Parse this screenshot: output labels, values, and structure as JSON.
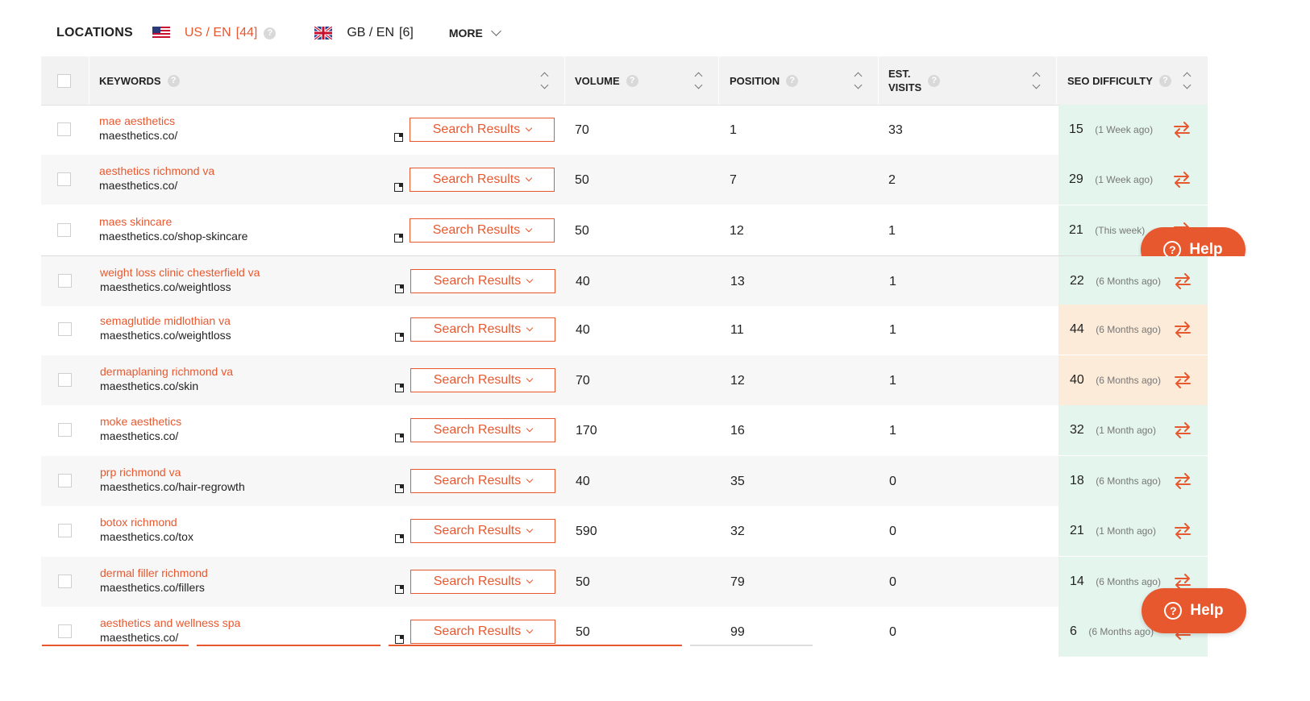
{
  "locations": {
    "title": "LOCATIONS",
    "us": {
      "label": "US / EN",
      "count": "[44]"
    },
    "gb": {
      "label": "GB / EN",
      "count": "[6]"
    },
    "more": "MORE"
  },
  "table": {
    "headers": {
      "keywords": "KEYWORDS",
      "volume": "VOLUME",
      "position": "POSITION",
      "visits_line1": "EST.",
      "visits_line2": "VISITS",
      "seo": "SEO DIFFICULTY"
    },
    "search_results_label": "Search Results",
    "rows": [
      {
        "keyword": "mae aesthetics",
        "url": "maesthetics.co/",
        "volume": "70",
        "position": "1",
        "visits": "33",
        "seo": "15",
        "ago": "(1 Week ago)",
        "level": "easy"
      },
      {
        "keyword": "aesthetics richmond va",
        "url": "maesthetics.co/",
        "volume": "50",
        "position": "7",
        "visits": "2",
        "seo": "29",
        "ago": "(1 Week ago)",
        "level": "easy"
      },
      {
        "keyword": "maes skincare",
        "url": "maesthetics.co/shop-skincare",
        "volume": "50",
        "position": "12",
        "visits": "1",
        "seo": "21",
        "ago": "(This week)",
        "level": "easy"
      },
      {
        "keyword": "weight loss clinic chesterfield va",
        "url": "maesthetics.co/weightloss",
        "volume": "40",
        "position": "13",
        "visits": "1",
        "seo": "22",
        "ago": "(6 Months ago)",
        "level": "easy"
      },
      {
        "keyword": "semaglutide midlothian va",
        "url": "maesthetics.co/weightloss",
        "volume": "40",
        "position": "11",
        "visits": "1",
        "seo": "44",
        "ago": "(6 Months ago)",
        "level": "medium"
      },
      {
        "keyword": "dermaplaning richmond va",
        "url": "maesthetics.co/skin",
        "volume": "70",
        "position": "12",
        "visits": "1",
        "seo": "40",
        "ago": "(6 Months ago)",
        "level": "medium"
      },
      {
        "keyword": "moke aesthetics",
        "url": "maesthetics.co/",
        "volume": "170",
        "position": "16",
        "visits": "1",
        "seo": "32",
        "ago": "(1 Month ago)",
        "level": "easy"
      },
      {
        "keyword": "prp richmond va",
        "url": "maesthetics.co/hair-regrowth",
        "volume": "40",
        "position": "35",
        "visits": "0",
        "seo": "18",
        "ago": "(6 Months ago)",
        "level": "easy"
      },
      {
        "keyword": "botox richmond",
        "url": "maesthetics.co/tox",
        "volume": "590",
        "position": "32",
        "visits": "0",
        "seo": "21",
        "ago": "(1 Month ago)",
        "level": "easy"
      },
      {
        "keyword": "dermal filler richmond",
        "url": "maesthetics.co/fillers",
        "volume": "50",
        "position": "79",
        "visits": "0",
        "seo": "14",
        "ago": "(6 Months ago)",
        "level": "easy"
      },
      {
        "keyword": "aesthetics and wellness spa",
        "url": "maesthetics.co/",
        "volume": "50",
        "position": "99",
        "visits": "0",
        "seo": "6",
        "ago": "(6 Months ago)",
        "level": "easy"
      }
    ]
  },
  "help": {
    "label": "Help",
    "icon": "question-circle-icon"
  },
  "colors": {
    "accent": "#e8582f",
    "seo_easy": "#e4f5ee",
    "seo_medium": "#fcebd9",
    "header_bg": "#f2f2f2"
  }
}
